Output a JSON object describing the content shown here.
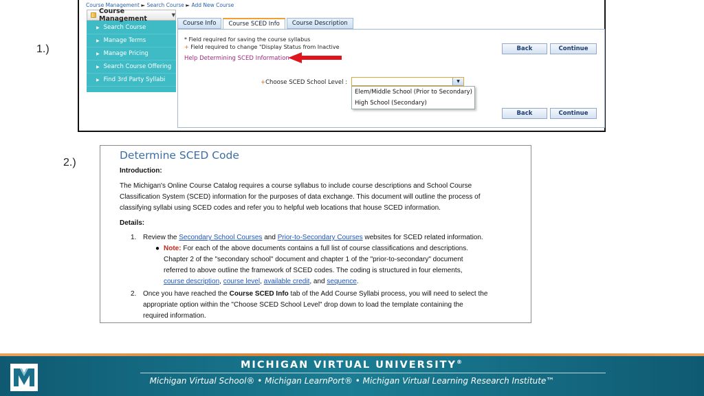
{
  "labels": {
    "step1": "1.)",
    "step2": "2.)"
  },
  "screenshot1": {
    "breadcrumb": [
      "Course Management",
      "Search Course",
      "Add New Course"
    ],
    "breadcrumb_sep": "►",
    "menu": {
      "header": "Course Management",
      "items": [
        "Search Course",
        "Manage Terms",
        "Manage Pricing",
        "Search Course Offering",
        "Find 3rd Party Syllabi"
      ]
    },
    "tabs": [
      {
        "label": "Course Info",
        "active": false
      },
      {
        "label": "Course SCED Info",
        "active": true
      },
      {
        "label": "Course Description",
        "active": false
      }
    ],
    "required_note_1": "* Field required for saving the course syllabus",
    "required_note_2_prefix": "+",
    "required_note_2": " Field required to change \"Display Status from Inactive",
    "help_link": "Help Determining SCED Information",
    "choose_label_prefix": "+",
    "choose_label": "Choose SCED School Level :",
    "select_value": "",
    "dropdown_options": [
      "Elem/Middle School (Prior to Secondary)",
      "High School (Secondary)"
    ],
    "buttons": {
      "back": "Back",
      "continue": "Continue"
    },
    "colors": {
      "menu_bg": "#3fbbc5",
      "arrow": "#e0161e",
      "active_tab_accent": "#f0a030",
      "help_link": "#a0287c"
    }
  },
  "screenshot2": {
    "title": "Determine SCED Code",
    "intro_heading": "Introduction:",
    "intro_lines": [
      "The Michigan's Online Course Catalog requires a course syllabus to include course descriptions and School Course",
      "Classification System (SCED) information for the purposes of data exchange. This document will outline the process of",
      "classifying syllabi using SCED codes and refer you to helpful web locations that house SCED information."
    ],
    "details_heading": "Details:",
    "item1": {
      "num": "1.",
      "pre": "Review the ",
      "link1": "Secondary School Courses",
      "mid": " and ",
      "link2": "Prior-to-Secondary Courses",
      "post": " websites for SCED related information."
    },
    "note": {
      "label": "Note:",
      "line1": " For each of the above documents contains a full list of course classifications and descriptions.",
      "line2": "Chapter 2 of the \"secondary school\" document and chapter 1 of the \"prior-to-secondary\" document",
      "line3": "referred to above outline the framework of SCED codes. The coding is structured in four elements,",
      "link_a": "course description",
      "link_b": "course level",
      "link_c": "available credit",
      "link_d": "sequence",
      "sep1": ", ",
      "sep2": ", ",
      "sep3": ", and ",
      "end": "."
    },
    "item2": {
      "num": "2.",
      "pre": "Once you have reached the ",
      "bold": "Course SCED Info",
      "post": " tab of the Add Course Syllabi process, you will need to select the",
      "line2": "appropriate option within the \"Choose SCED School Level\" drop down to load the template containing the",
      "line3": "required information."
    }
  },
  "footer": {
    "brand": "MICHIGAN VIRTUAL UNIVERSITY",
    "brand_mark": "®",
    "tagline": "Michigan Virtual School® • Michigan LearnPort® • Michigan Virtual Learning Research Institute™",
    "colors": {
      "bar": "#1a7d93",
      "accent": "#d07a2c"
    }
  }
}
